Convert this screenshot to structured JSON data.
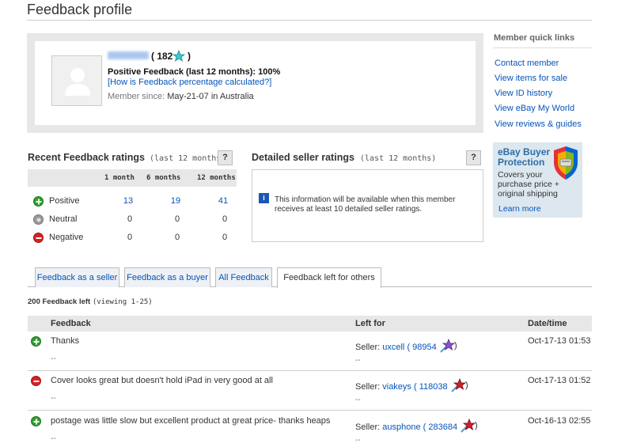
{
  "header": {
    "title": "Feedback profile"
  },
  "profile": {
    "score": "( 182",
    "score_close": ")",
    "positive_feedback": "Positive Feedback (last 12 months): 100%",
    "how_calculated_link": "[How is Feedback percentage calculated?]",
    "member_since_label": "Member since:",
    "member_since_value": "May-21-07 in Australia"
  },
  "quick_links": {
    "title": "Member quick links",
    "items": [
      "Contact member",
      "View items for sale",
      "View ID history",
      "View eBay My World",
      "View reviews & guides"
    ]
  },
  "buyer_protection": {
    "title": "eBay Buyer Protection",
    "description": "Covers your purchase price + original shipping",
    "learn_more": "Learn more"
  },
  "recent_feedback": {
    "title": "Recent Feedback ratings",
    "subtitle": "(last 12 months)",
    "help": "?",
    "columns": [
      "1 month",
      "6 months",
      "12 months"
    ],
    "rows": [
      {
        "label": "Positive",
        "values": [
          "13",
          "19",
          "41"
        ]
      },
      {
        "label": "Neutral",
        "values": [
          "0",
          "0",
          "0"
        ]
      },
      {
        "label": "Negative",
        "values": [
          "0",
          "0",
          "0"
        ]
      }
    ]
  },
  "detailed_ratings": {
    "title": "Detailed seller ratings",
    "subtitle": "(last 12 months)",
    "help": "?",
    "info_icon": "i",
    "message": "This information will be available when this member receives at least 10 detailed seller ratings."
  },
  "tabs": [
    "Feedback as a seller",
    "Feedback as a buyer",
    "All Feedback",
    "Feedback left for others"
  ],
  "feedback_left": {
    "count": "200 Feedback left",
    "viewing": "(viewing 1-25)"
  },
  "table": {
    "headers": [
      "Feedback",
      "Left for",
      "Date/time"
    ],
    "rows": [
      {
        "type": "positive",
        "text": "Thanks",
        "dash1": "--",
        "seller_label": "Seller:",
        "seller": "uxcell",
        "seller_score": "( 98954",
        "star_color": "#8a4fd1",
        "dash2": "--",
        "date": "Oct-17-13 01:53"
      },
      {
        "type": "negative",
        "text": "Cover looks great but doesn't hold iPad in very good at all",
        "dash1": "--",
        "seller_label": "Seller:",
        "seller": "viakeys",
        "seller_score": "( 118038",
        "star_color": "#d11d2a",
        "dash2": "--",
        "date": "Oct-17-13 01:52"
      },
      {
        "type": "positive",
        "text": "postage was little slow but excellent product at great price- thanks heaps",
        "dash1": "--",
        "seller_label": "Seller:",
        "seller": "ausphone",
        "seller_score": "( 283684",
        "star_color": "#d11d2a",
        "dash2": "--",
        "date": "Oct-16-13 02:55"
      }
    ]
  },
  "colors": {
    "link": "#0654ba",
    "turquoise_star": "#3bc6d4",
    "positive": "#2e9e2e",
    "negative": "#d62222"
  }
}
